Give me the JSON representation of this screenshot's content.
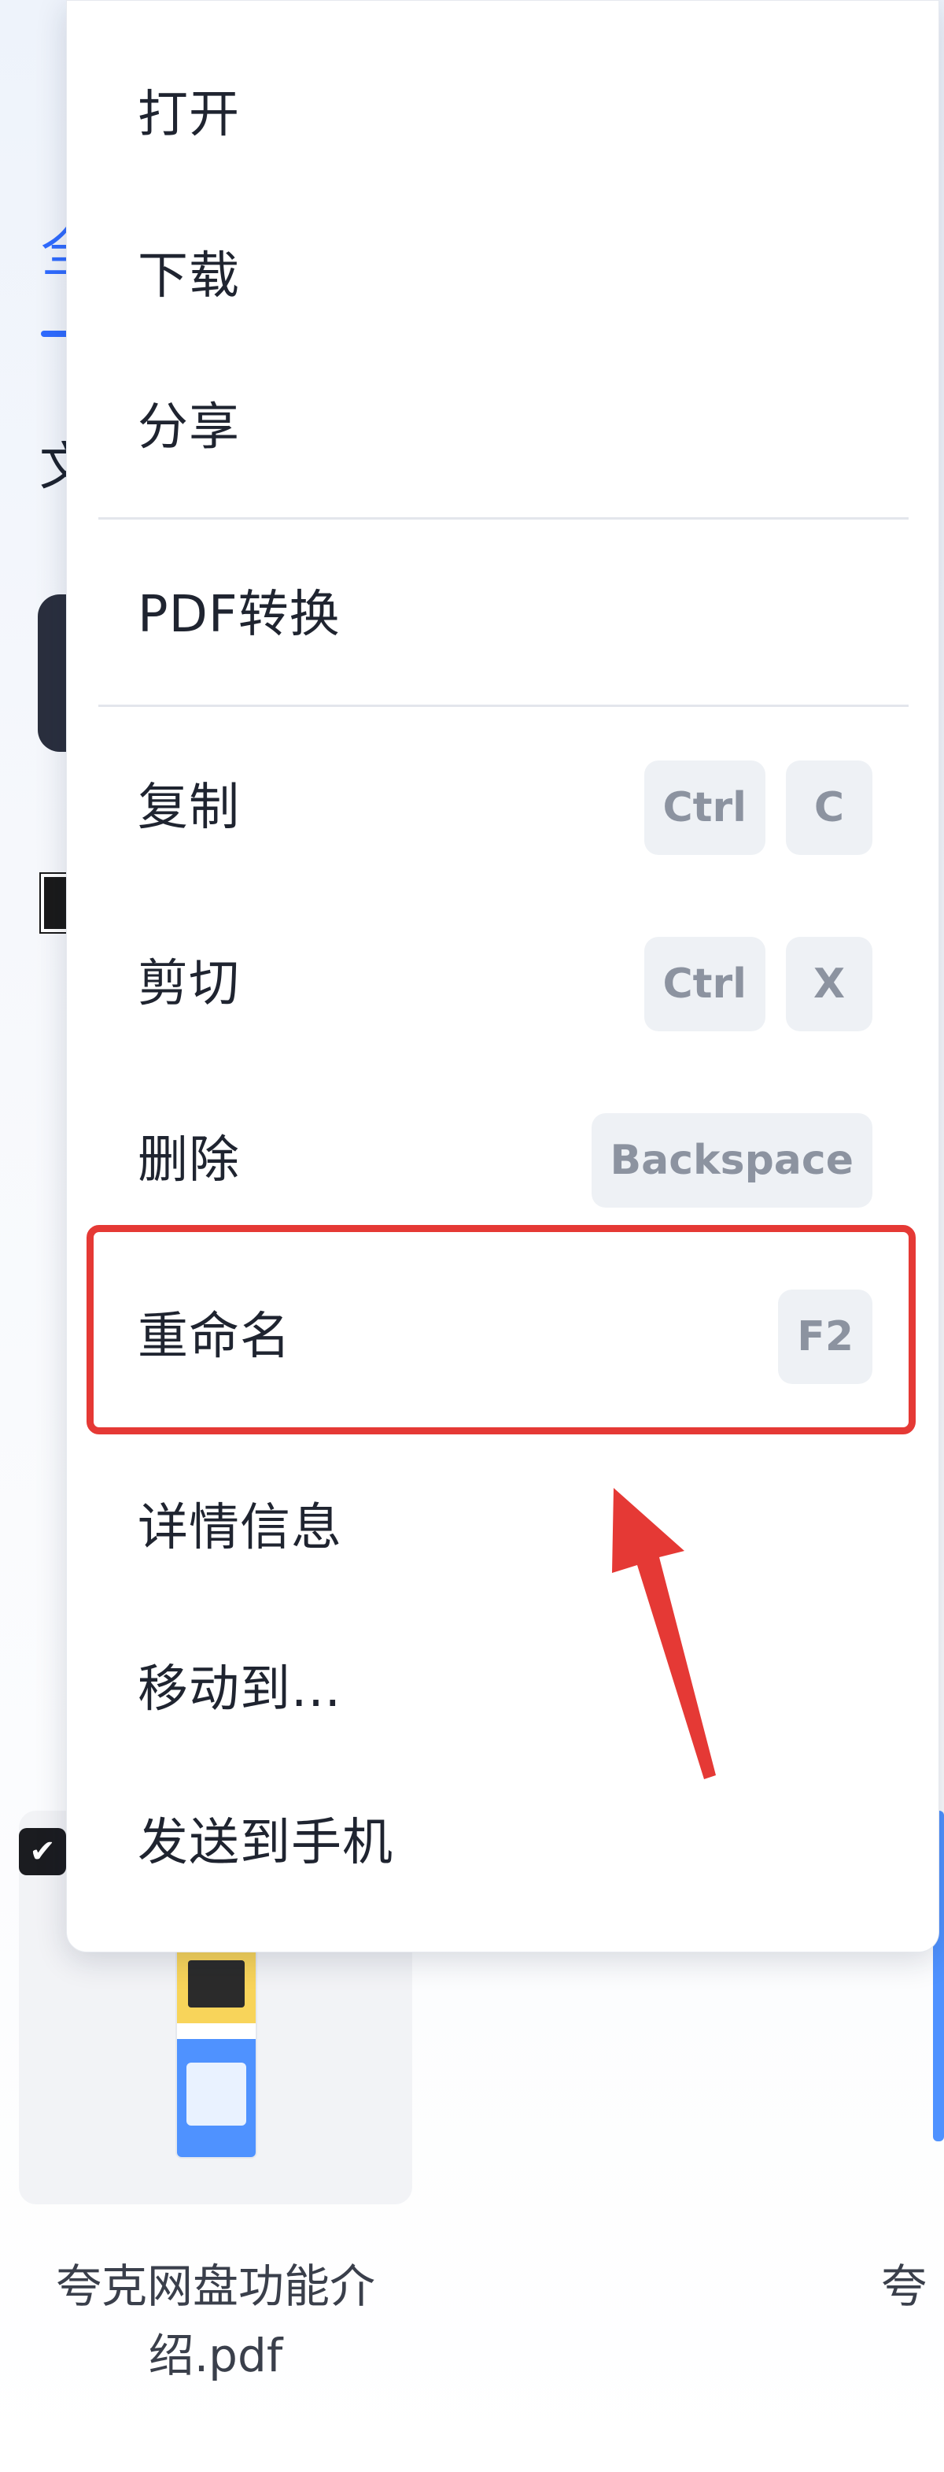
{
  "background": {
    "tab_fragment": "全",
    "heading_fragment": "文",
    "file_name": "夸克网盘功能介绍.pdf",
    "right_file_fragment": "夸",
    "file_checkbox_icon": "check-icon"
  },
  "context_menu": {
    "items": [
      {
        "label": "打开"
      },
      {
        "label": "下载"
      },
      {
        "label": "分享"
      },
      {
        "label": "PDF转换"
      },
      {
        "label": "复制",
        "shortcut": [
          "Ctrl",
          "C"
        ]
      },
      {
        "label": "剪切",
        "shortcut": [
          "Ctrl",
          "X"
        ]
      },
      {
        "label": "删除",
        "shortcut": [
          "Backspace"
        ]
      },
      {
        "label": "重命名",
        "shortcut": [
          "F2"
        ]
      },
      {
        "label": "详情信息"
      },
      {
        "label": "移动到..."
      },
      {
        "label": "发送到手机"
      }
    ]
  },
  "annotation": {
    "highlight_color": "#e53935",
    "highlighted_item": "重命名"
  },
  "colors": {
    "accent": "#2f6bff",
    "menu_text": "#1f2430",
    "kbd_text": "#8c93a0",
    "kbd_bg": "#eef1f5"
  }
}
